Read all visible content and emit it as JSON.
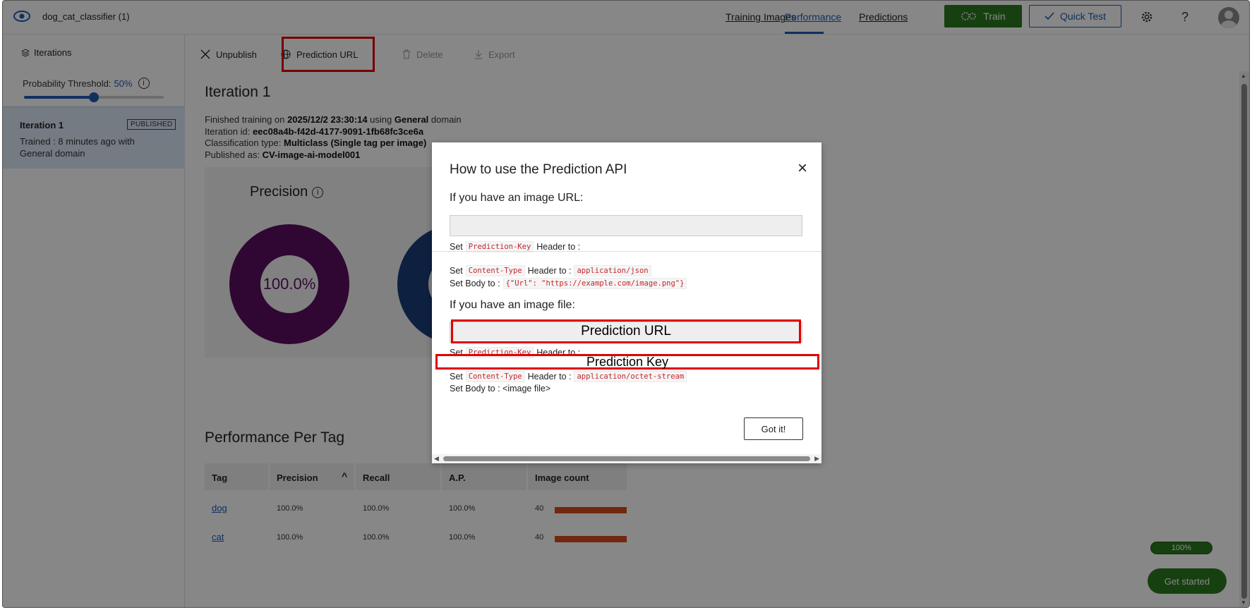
{
  "header": {
    "project_name": "dog_cat_classifier (1)",
    "nav": {
      "training_images": "Training Images",
      "performance": "Performance",
      "predictions": "Predictions"
    },
    "train_label": "Train",
    "quick_test_label": "Quick Test",
    "help_glyph": "?",
    "icons": {
      "logo": "eye-icon",
      "train": "gears-icon",
      "quick_test": "checkmark-icon",
      "settings": "gear-icon",
      "help": "question-icon",
      "avatar": "user-avatar-icon"
    }
  },
  "sidebar": {
    "iterations_label": "Iterations",
    "threshold_label": "Probability Threshold:",
    "threshold_value": "50%",
    "threshold_fraction": 0.5,
    "info_glyph": "i",
    "iteration": {
      "name": "Iteration 1",
      "badge": "PUBLISHED",
      "desc": "Trained : 8 minutes ago with General domain"
    }
  },
  "toolbar": {
    "unpublish": "Unpublish",
    "prediction_url": "Prediction URL",
    "delete": "Delete",
    "export": "Export"
  },
  "main": {
    "iteration_title": "Iteration 1",
    "details": {
      "finished_prefix": "Finished training on ",
      "finished_date": "2025/12/2 23:30:14",
      "using": " using ",
      "domain": "General",
      "domain_suffix": " domain",
      "iteration_id_label": "Iteration id: ",
      "iteration_id": "eec08a4b-f42d-4177-9091-1fb68fc3ce6a",
      "classification_label": "Classification type: ",
      "classification": "Multiclass (Single tag per image)",
      "published_label": "Published as: ",
      "published": "CV-image-ai-model001"
    },
    "precision_title": "Precision",
    "precision_value": "100.0%",
    "precision_fraction": 1.0,
    "performance_per_tag": "Performance Per Tag",
    "sort_glyph": "^",
    "table": {
      "headers": [
        "Tag",
        "Precision",
        "Recall",
        "A.P.",
        "Image count"
      ],
      "rows": [
        {
          "tag": "dog",
          "precision": "100.0%",
          "recall": "100.0%",
          "ap": "100.0%",
          "count": "40",
          "count_fraction": 1.0
        },
        {
          "tag": "cat",
          "precision": "100.0%",
          "recall": "100.0%",
          "ap": "100.0%",
          "count": "40",
          "count_fraction": 1.0
        }
      ]
    },
    "progress_pill": "100%",
    "get_started": "Get started"
  },
  "modal": {
    "title": "How to use the Prediction API",
    "close_glyph": "×",
    "url_heading": "If you have an image URL:",
    "set": "Set",
    "set_body": "Set Body to :",
    "prediction_key_code": "Prediction-Key",
    "header_to": "Header to :",
    "content_type_code": "Content-Type",
    "json_code": "application/json",
    "body_code": "{\"Url\": \"https://example.com/image.png\"}",
    "file_heading": "If you have an image file:",
    "octet_code": "application/octet-stream",
    "body_file": "Set Body to : <image file>",
    "callout_url": "Prediction URL",
    "callout_key": "Prediction Key",
    "got_it": "Got it!"
  },
  "colors": {
    "accent": "#1f5bb5",
    "train_green": "#2d7a1f",
    "precision_purple": "#5b0e60",
    "recall_blue": "#1b3d7a",
    "bar_orange": "#d84a1e",
    "highlight_red": "#e00000"
  }
}
